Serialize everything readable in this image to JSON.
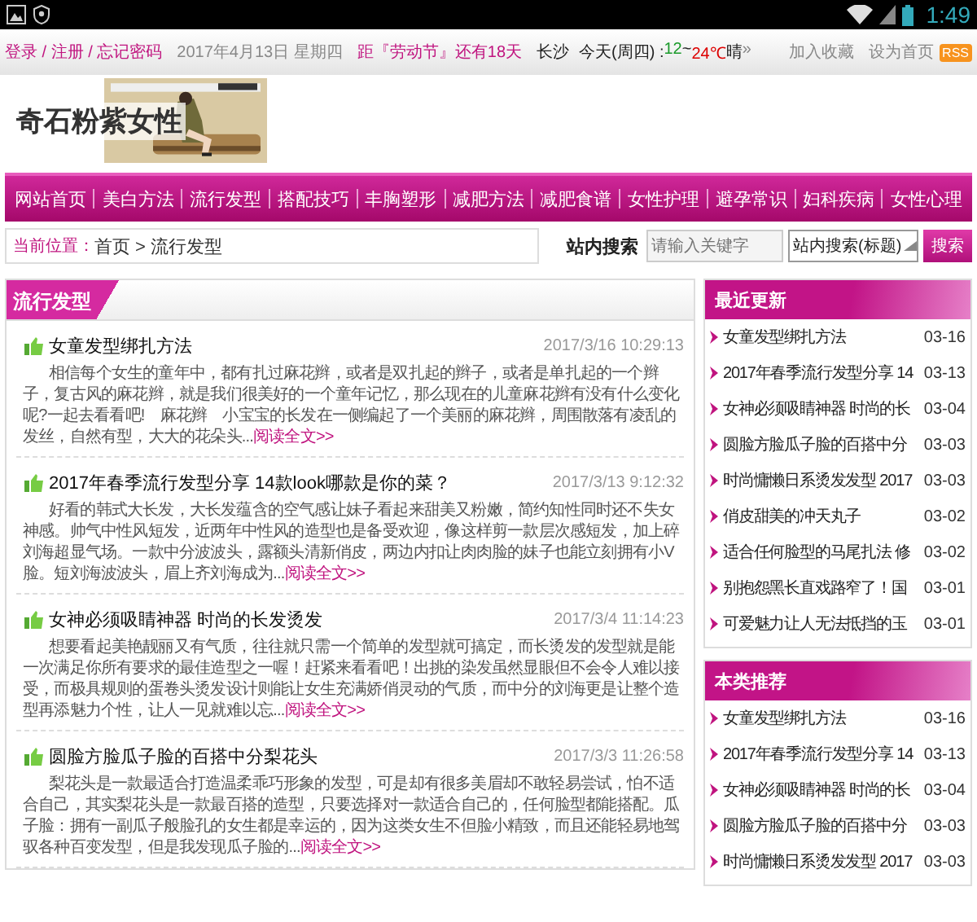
{
  "status_bar": {
    "time": "1:49"
  },
  "top_bar": {
    "account_links": "登录 / 注册 / 忘记密码",
    "date": "2017年4月13日 星期四",
    "countdown": "距『劳动节』还有18天",
    "city": "长沙",
    "weather_label": "今天(周四) : ",
    "temp_low": "12",
    "temp_sep": "~",
    "temp_high": "24℃",
    "weather": "晴",
    "more": "»",
    "right_links": [
      "加入收藏",
      "设为首页"
    ],
    "rss": "RSS"
  },
  "header": {
    "logo": "奇石粉紫女性"
  },
  "nav": [
    "网站首页",
    "美白方法",
    "流行发型",
    "搭配技巧",
    "丰胸塑形",
    "减肥方法",
    "减肥食谱",
    "女性护理",
    "避孕常识",
    "妇科疾病",
    "女性心理"
  ],
  "breadcrumb": {
    "label": "当前位置：",
    "path": "首页 > 流行发型"
  },
  "search": {
    "label": "站内搜索",
    "placeholder": "请输入关键字",
    "scope": "站内搜索(标题)",
    "button": "搜索"
  },
  "main": {
    "title": "流行发型",
    "articles": [
      {
        "title": "女童发型绑扎方法",
        "date": "2017/3/16 10:29:13",
        "summary": "相信每个女生的童年中，都有扎过麻花辫，或者是双扎起的辫子，或者是单扎起的一个辫子，复古风的麻花辫，就是我们很美好的一个童年记忆，那么现在的儿童麻花辫有没有什么变化呢?一起去看看吧!　麻花辫　小宝宝的长发在一侧编起了一个美丽的麻花辫，周围散落有凌乱的发丝，自然有型，大大的花朵头...",
        "more": "阅读全文>>"
      },
      {
        "title": "2017年春季流行发型分享 14款look哪款是你的菜？",
        "date": "2017/3/13 9:12:32",
        "summary": "好看的韩式大长发，大长发蕴含的空气感让妹子看起来甜美又粉嫩，简约知性同时还不失女神感。帅气中性风短发，近两年中性风的造型也是备受欢迎，像这样剪一款层次感短发，加上碎刘海超显气场。一款中分波波头，露额头清新俏皮，两边内扣让肉肉脸的妹子也能立刻拥有小V脸。短刘海波波头，眉上齐刘海成为...",
        "more": "阅读全文>>"
      },
      {
        "title": "女神必须吸睛神器 时尚的长发烫发",
        "date": "2017/3/4 11:14:23",
        "summary": "想要看起美艳靓丽又有气质，往往就只需一个简单的发型就可搞定，而长烫发的发型就是能一次满足你所有要求的最佳造型之一喔！赶紧来看看吧！出挑的染发虽然显眼但不会令人难以接受，而极具规则的蛋卷头烫发设计则能让女生充满娇俏灵动的气质，而中分的刘海更是让整个造型再添魅力个性，让人一见就难以忘...",
        "more": "阅读全文>>"
      },
      {
        "title": "圆脸方脸瓜子脸的百搭中分梨花头",
        "date": "2017/3/3 11:26:58",
        "summary": "梨花头是一款最适合打造温柔乖巧形象的发型，可是却有很多美眉却不敢轻易尝试，怕不适合自己，其实梨花头是一款最百搭的造型，只要选择对一款适合自己的，任何脸型都能搭配。瓜子脸：拥有一副瓜子般脸孔的女生都是幸运的，因为这类女生不但脸小精致，而且还能轻易地驾驭各种百变发型，但是我发现瓜子脸的...",
        "more": "阅读全文>>"
      }
    ]
  },
  "sidebar": [
    {
      "title": "最近更新",
      "items": [
        {
          "text": "女童发型绑扎方法",
          "date": "03-16"
        },
        {
          "text": "2017年春季流行发型分享 14",
          "date": "03-13"
        },
        {
          "text": "女神必须吸睛神器 时尚的长",
          "date": "03-04"
        },
        {
          "text": "圆脸方脸瓜子脸的百搭中分",
          "date": "03-03"
        },
        {
          "text": "时尚慵懒日系烫发发型 2017",
          "date": "03-03"
        },
        {
          "text": "俏皮甜美的冲天丸子",
          "date": "03-02"
        },
        {
          "text": "适合任何脸型的马尾扎法 修",
          "date": "03-02"
        },
        {
          "text": "别抱怨黑长直戏路窄了！国",
          "date": "03-01"
        },
        {
          "text": "可爱魅力让人无法抵挡的玉",
          "date": "03-01"
        }
      ]
    },
    {
      "title": "本类推荐",
      "items": [
        {
          "text": "女童发型绑扎方法",
          "date": "03-16"
        },
        {
          "text": "2017年春季流行发型分享 14",
          "date": "03-13"
        },
        {
          "text": "女神必须吸睛神器 时尚的长",
          "date": "03-04"
        },
        {
          "text": "圆脸方脸瓜子脸的百搭中分",
          "date": "03-03"
        },
        {
          "text": "时尚慵懒日系烫发发型 2017",
          "date": "03-03"
        }
      ]
    }
  ]
}
